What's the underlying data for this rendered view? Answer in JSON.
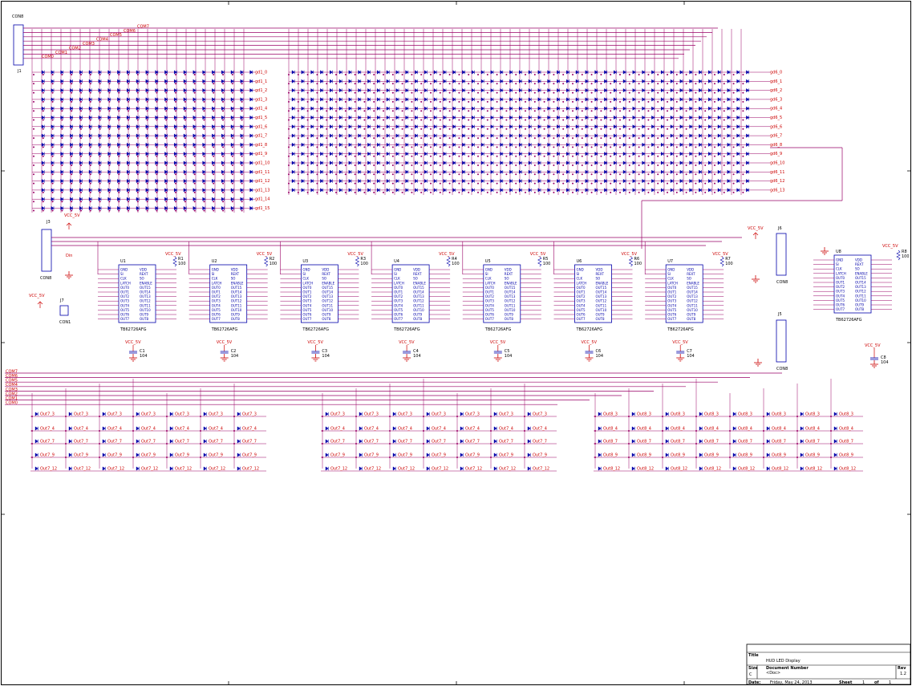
{
  "connectors": {
    "j1": {
      "ref": "J1",
      "type": "CON8",
      "nets": [
        "COM0",
        "COM1",
        "COM2",
        "COM3",
        "COM4",
        "COM5",
        "COM6",
        "COM7"
      ]
    },
    "j3": {
      "ref": "J3",
      "type": "CON8",
      "net_din": "Din",
      "power": "VCC_5V"
    },
    "j7": {
      "ref": "J7",
      "type": "CON1",
      "power": "VCC_5V"
    },
    "j6": {
      "ref": "J6",
      "type": "CON8",
      "power": "VCC_5V"
    },
    "j5": {
      "ref": "J5",
      "type": "CON8"
    }
  },
  "top_left_rows": [
    "gd1_0",
    "gd1_1",
    "gd1_2",
    "gd1_3",
    "gd1_4",
    "gd1_5",
    "gd1_6",
    "gd1_7",
    "gd1_8",
    "gd1_9",
    "gd1_10",
    "gd1_11",
    "gd1_12",
    "gd1_13",
    "gd1_14",
    "gd1_15"
  ],
  "top_right_rows": [
    "gd6_0",
    "gd6_1",
    "gd6_2",
    "gd6_3",
    "gd6_4",
    "gd6_5",
    "gd6_6",
    "gd6_7",
    "gd6_8",
    "gd6_9",
    "gd6_10",
    "gd6_11",
    "gd6_12",
    "gd6_13"
  ],
  "drivers": [
    {
      "ref": "U1",
      "part": "TB62726AFG",
      "res": "R1",
      "res_val": "100",
      "cap": "C1",
      "cap_val": "104"
    },
    {
      "ref": "U2",
      "part": "TB62726AFG",
      "res": "R2",
      "res_val": "100",
      "cap": "C2",
      "cap_val": "104"
    },
    {
      "ref": "U3",
      "part": "TB62726AFG",
      "res": "R3",
      "res_val": "100",
      "cap": "C3",
      "cap_val": "104"
    },
    {
      "ref": "U4",
      "part": "TB62726AFG",
      "res": "R4",
      "res_val": "100",
      "cap": "C4",
      "cap_val": "104"
    },
    {
      "ref": "U5",
      "part": "TB62726AFG",
      "res": "R5",
      "res_val": "100",
      "cap": "C5",
      "cap_val": "104"
    },
    {
      "ref": "U6",
      "part": "TB62726AFG",
      "res": "R6",
      "res_val": "100",
      "cap": "C6",
      "cap_val": "104"
    },
    {
      "ref": "U7",
      "part": "TB62726AFG",
      "res": "R7",
      "res_val": "100",
      "cap": "C7",
      "cap_val": "104"
    }
  ],
  "driver8": {
    "ref": "U8",
    "part": "TB62726AFG",
    "res": "R8",
    "res_val": "100",
    "cap": "C8",
    "cap_val": "104"
  },
  "ic_pins_left": [
    "GND",
    "SI",
    "CLK",
    "LATCH",
    "OUT0",
    "OUT1",
    "OUT2",
    "OUT3",
    "OUT4",
    "OUT5",
    "OUT6",
    "OUT7"
  ],
  "ic_pins_right": [
    "VDD",
    "REXT",
    "SO",
    "ENABLE",
    "OUT15",
    "OUT14",
    "OUT13",
    "OUT12",
    "OUT11",
    "OUT10",
    "OUT9",
    "OUT8"
  ],
  "power_label": "VCC_5V",
  "bottom_bus": [
    "COM7",
    "COM6",
    "COM5",
    "COM4",
    "COM3",
    "COM2",
    "COM1",
    "COM0"
  ],
  "bottom_groups": [
    {
      "rows": [
        "Out7_3",
        "Out7_4",
        "Out7_7",
        "Out7_9",
        "Out7_12"
      ]
    },
    {
      "rows": [
        "Out7_3",
        "Out7_4",
        "Out7_7",
        "Out7_9",
        "Out7_12"
      ]
    },
    {
      "rows": [
        "Out8_3",
        "Out8_4",
        "Out8_7",
        "Out8_9",
        "Out8_12"
      ]
    }
  ],
  "title_block": {
    "title_label": "Title",
    "title": "HUD LED Display",
    "size_label": "Size",
    "size": "C",
    "docnum_label": "Document Number",
    "docnum": "<Doc>",
    "rev_label": "Rev",
    "rev": "1.2",
    "date_label": "Date:",
    "date": "Friday, May 24, 2013",
    "sheet_label": "Sheet",
    "sheet": "1",
    "of_label": "of",
    "sheets": "1"
  },
  "colors": {
    "wire": "#990066",
    "net": "#cc0000",
    "part": "#0000aa",
    "frame": "#000000"
  }
}
